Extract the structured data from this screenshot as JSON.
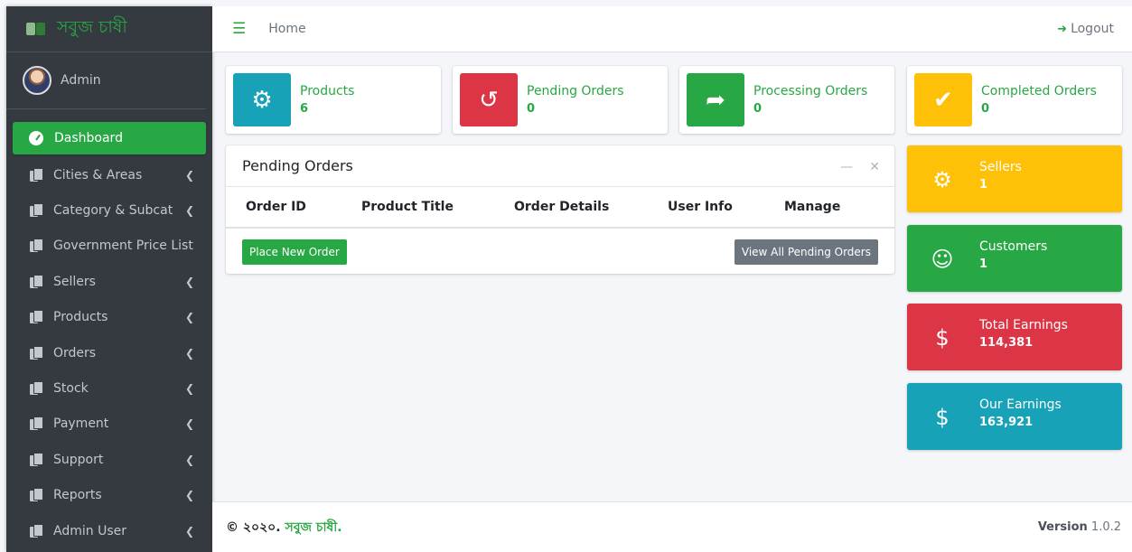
{
  "brand": {
    "name": "সবুজ চাষী"
  },
  "user": {
    "name": "Admin"
  },
  "sidebar": {
    "items": [
      {
        "label": "Dashboard",
        "active": true
      },
      {
        "label": "Cities & Areas"
      },
      {
        "label": "Category & Subcat"
      },
      {
        "label": "Government Price List"
      },
      {
        "label": "Sellers"
      },
      {
        "label": "Products"
      },
      {
        "label": "Orders"
      },
      {
        "label": "Stock"
      },
      {
        "label": "Payment"
      },
      {
        "label": "Support"
      },
      {
        "label": "Reports"
      },
      {
        "label": "Admin User"
      }
    ]
  },
  "topbar": {
    "home": "Home",
    "logout": "Logout"
  },
  "info_boxes": [
    {
      "label": "Products",
      "value": "6",
      "color": "#17a2b8",
      "icon": "gear-icon"
    },
    {
      "label": "Pending Orders",
      "value": "0",
      "color": "#dc3545",
      "icon": "history-icon"
    },
    {
      "label": "Processing Orders",
      "value": "0",
      "color": "#28a745",
      "icon": "share-icon"
    },
    {
      "label": "Completed Orders",
      "value": "0",
      "color": "#ffc107",
      "icon": "clipboard-check-icon"
    }
  ],
  "pending_card": {
    "title": "Pending Orders",
    "columns": [
      "Order ID",
      "Product Title",
      "Order Details",
      "User Info",
      "Manage"
    ],
    "place_order": "Place New Order",
    "view_all": "View All Pending Orders"
  },
  "stat_boxes": [
    {
      "label": "Sellers",
      "value": "1",
      "color": "#ffc107",
      "icon": "user-gear-icon"
    },
    {
      "label": "Customers",
      "value": "1",
      "color": "#28a745",
      "icon": "user-icon"
    },
    {
      "label": "Total Earnings",
      "value": "114,381",
      "color": "#dc3545",
      "icon": "invoice-dollar-icon"
    },
    {
      "label": "Our Earnings",
      "value": "163,921",
      "color": "#17a2b8",
      "icon": "hand-dollar-icon"
    }
  ],
  "footer": {
    "copyright_prefix": "© ২০২০.",
    "copyright_brand": "সবুজ চাষী.",
    "version_label": "Version",
    "version": "1.0.2"
  }
}
